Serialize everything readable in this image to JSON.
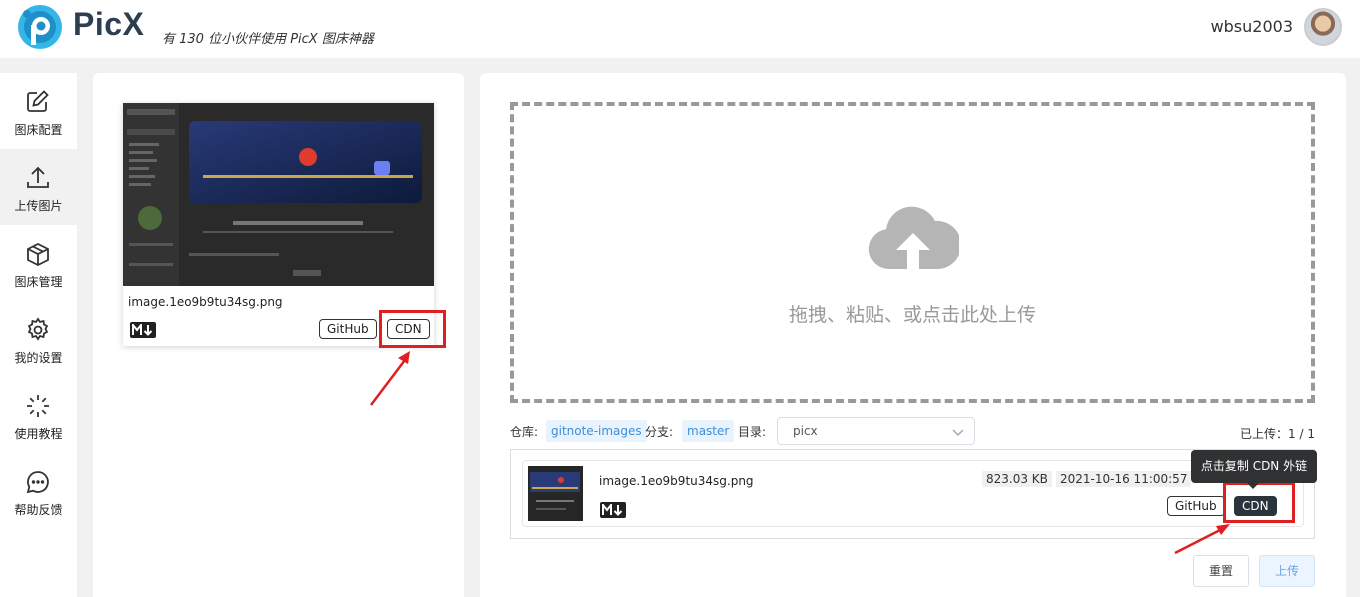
{
  "header": {
    "app_name": "PicX",
    "tagline": "有 130 位小伙伴使用 PicX 图床神器",
    "username": "wbsu2003"
  },
  "sidebar": {
    "items": [
      {
        "label": "图床配置",
        "icon": "edit-icon"
      },
      {
        "label": "上传图片",
        "icon": "upload-icon",
        "active": true
      },
      {
        "label": "图床管理",
        "icon": "package-icon"
      },
      {
        "label": "我的设置",
        "icon": "gear-icon"
      },
      {
        "label": "使用教程",
        "icon": "loader-icon"
      },
      {
        "label": "帮助反馈",
        "icon": "chat-icon"
      }
    ]
  },
  "preview_card": {
    "filename": "image.1eo9b9tu34sg.png",
    "github_label": "GitHub",
    "cdn_label": "CDN",
    "image_texts": {
      "brand": "Synology",
      "lastfm": "last.fm",
      "banner": "高颜值的第三方网易云播放器YesPlayMusic",
      "caption": "高颜值的第三方网易云播放器YesPlayMusic",
      "docker": "docker"
    }
  },
  "upload": {
    "drop_text": "拖拽、粘贴、或点击此处上传",
    "repo_label": "仓库:",
    "repo_value": "gitnote-images",
    "branch_label": "分支:",
    "branch_value": "master",
    "dir_label": "目录:",
    "dir_value": "picx",
    "uploaded_count": "已上传：1 / 1"
  },
  "upload_item": {
    "filename": "image.1eo9b9tu34sg.png",
    "size": "823.03 KB",
    "datetime": "2021-10-16 11:00:57",
    "github_label": "GitHub",
    "cdn_label": "CDN",
    "tooltip": "点击复制 CDN 外链"
  },
  "actions": {
    "reset_label": "重置",
    "upload_label": "上传"
  },
  "colors": {
    "highlight_red": "#e02020",
    "chip_blue": "#3c8fd8",
    "brand_teal": "#1e9bd7"
  }
}
